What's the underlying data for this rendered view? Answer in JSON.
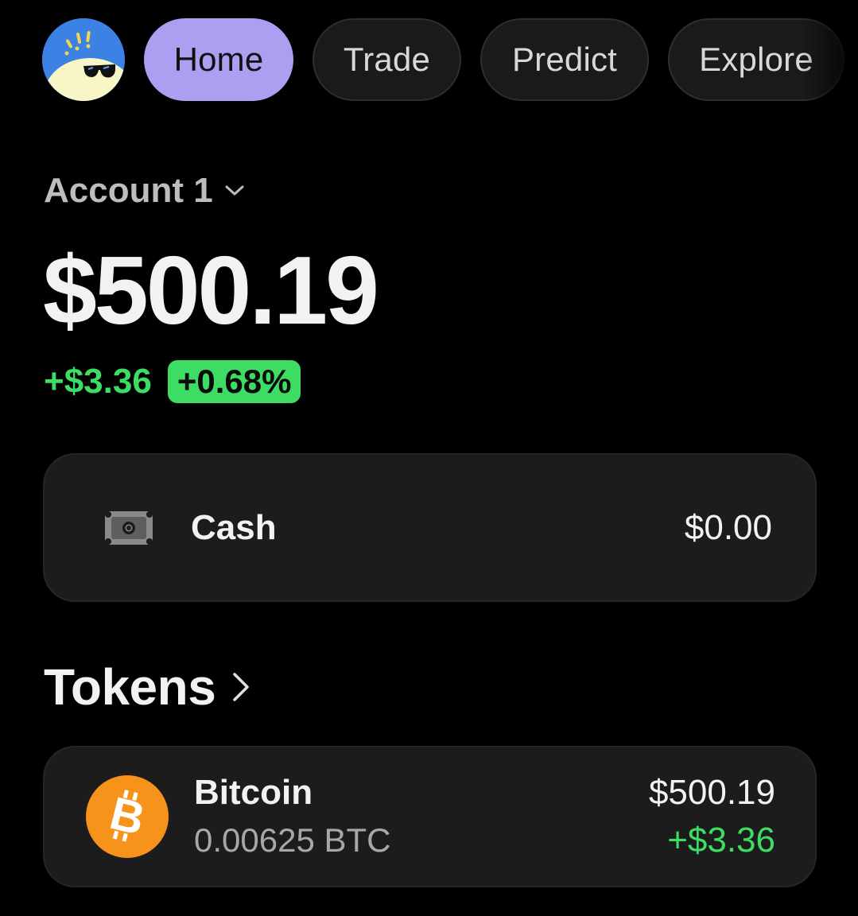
{
  "colors": {
    "background": "#000000",
    "accent": "#ab9ff2",
    "positive": "#3ddc63",
    "card": "#1c1c1c",
    "bitcoin": "#f7931a"
  },
  "nav": {
    "avatar_icon": "cool-bird-avatar-icon",
    "tabs": [
      {
        "label": "Home",
        "active": true
      },
      {
        "label": "Trade",
        "active": false
      },
      {
        "label": "Predict",
        "active": false
      },
      {
        "label": "Explore",
        "active": false
      }
    ]
  },
  "account": {
    "name": "Account 1",
    "balance": "$500.19",
    "change_abs": "+$3.36",
    "change_pct": "+0.68%"
  },
  "cash": {
    "icon": "cash-icon",
    "label": "Cash",
    "value": "$0.00"
  },
  "tokens": {
    "title": "Tokens",
    "items": [
      {
        "icon": "bitcoin-icon",
        "name": "Bitcoin",
        "amount": "0.00625 BTC",
        "value": "$500.19",
        "change": "+$3.36"
      }
    ]
  }
}
